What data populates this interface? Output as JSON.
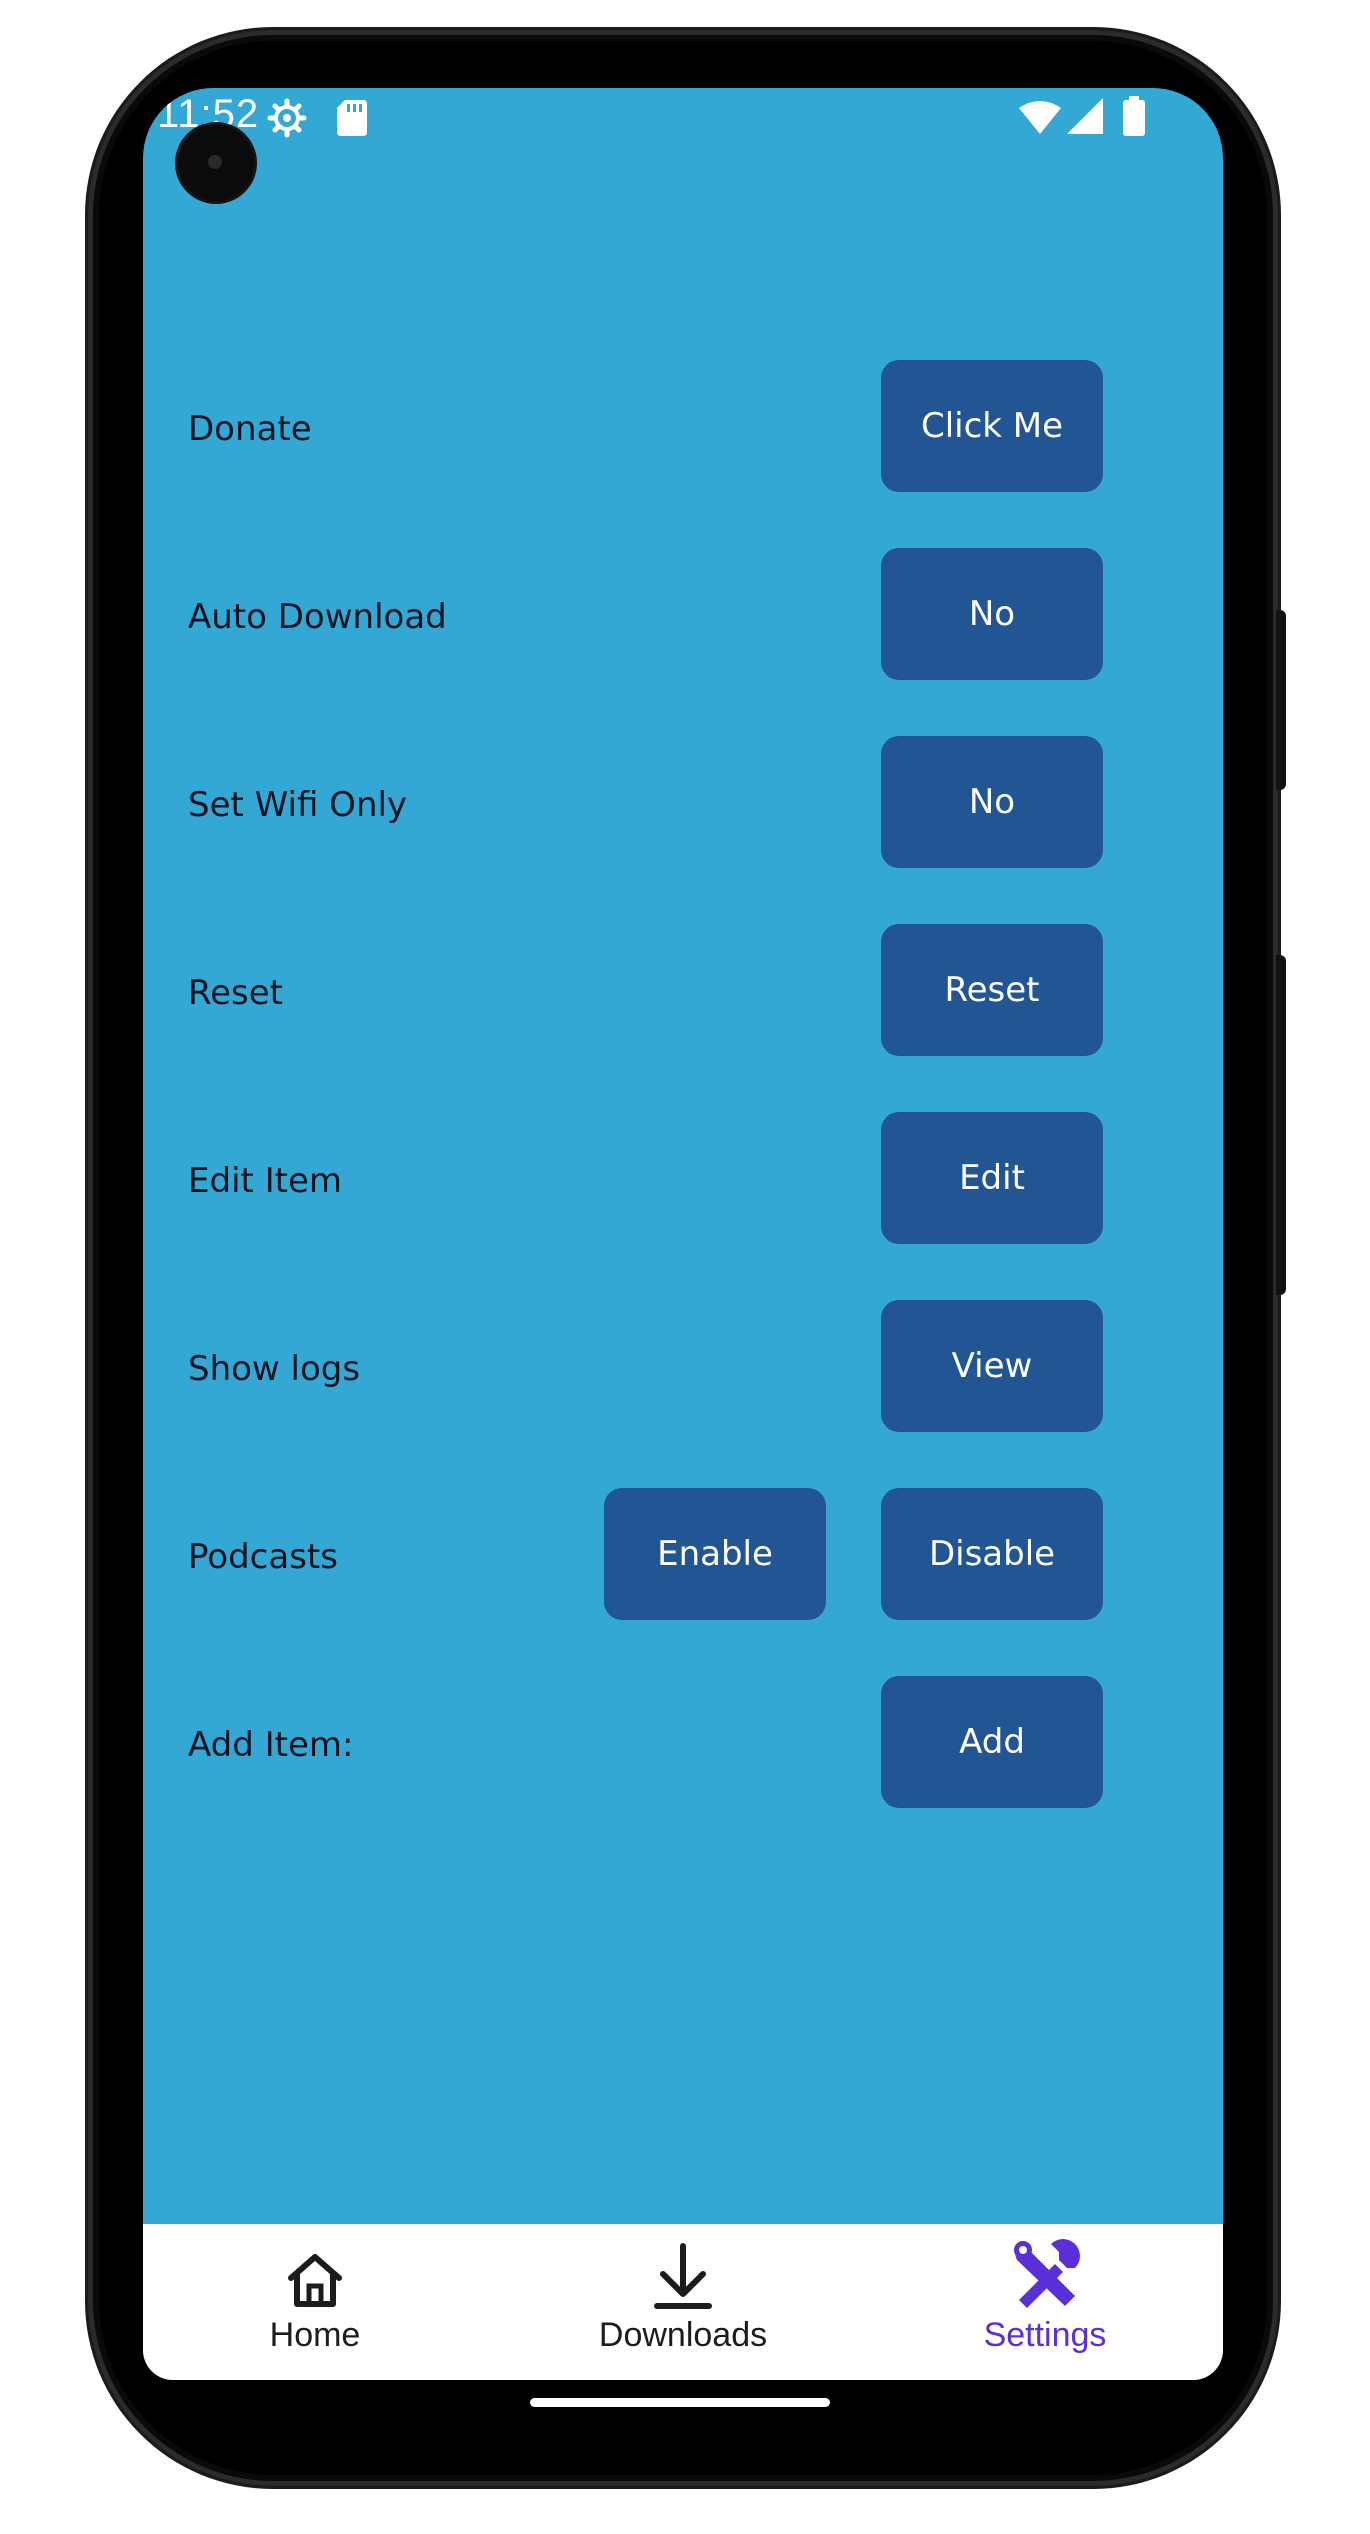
{
  "status_bar": {
    "time": "11:52"
  },
  "settings": [
    {
      "label": "Donate",
      "buttons": [
        "Click Me"
      ]
    },
    {
      "label": "Auto Download",
      "buttons": [
        "No"
      ]
    },
    {
      "label": "Set Wifi Only",
      "buttons": [
        "No"
      ]
    },
    {
      "label": "Reset",
      "buttons": [
        "Reset"
      ]
    },
    {
      "label": "Edit Item",
      "buttons": [
        "Edit"
      ]
    },
    {
      "label": "Show logs",
      "buttons": [
        "View"
      ]
    },
    {
      "label": "Podcasts",
      "buttons": [
        "Enable",
        "Disable"
      ]
    },
    {
      "label": "Add Item:",
      "buttons": [
        "Add"
      ]
    }
  ],
  "bottom_nav": {
    "items": [
      {
        "label": "Home",
        "icon": "home-icon",
        "active": false
      },
      {
        "label": "Downloads",
        "icon": "download-icon",
        "active": false
      },
      {
        "label": "Settings",
        "icon": "settings-tools-icon",
        "active": true
      }
    ]
  },
  "colors": {
    "background": "#33a8d5",
    "button": "#215593",
    "button_text": "#ffffff",
    "label_text": "#0c1420",
    "nav_active": "#5b2fd8",
    "nav_inactive": "#1c1c1c"
  }
}
